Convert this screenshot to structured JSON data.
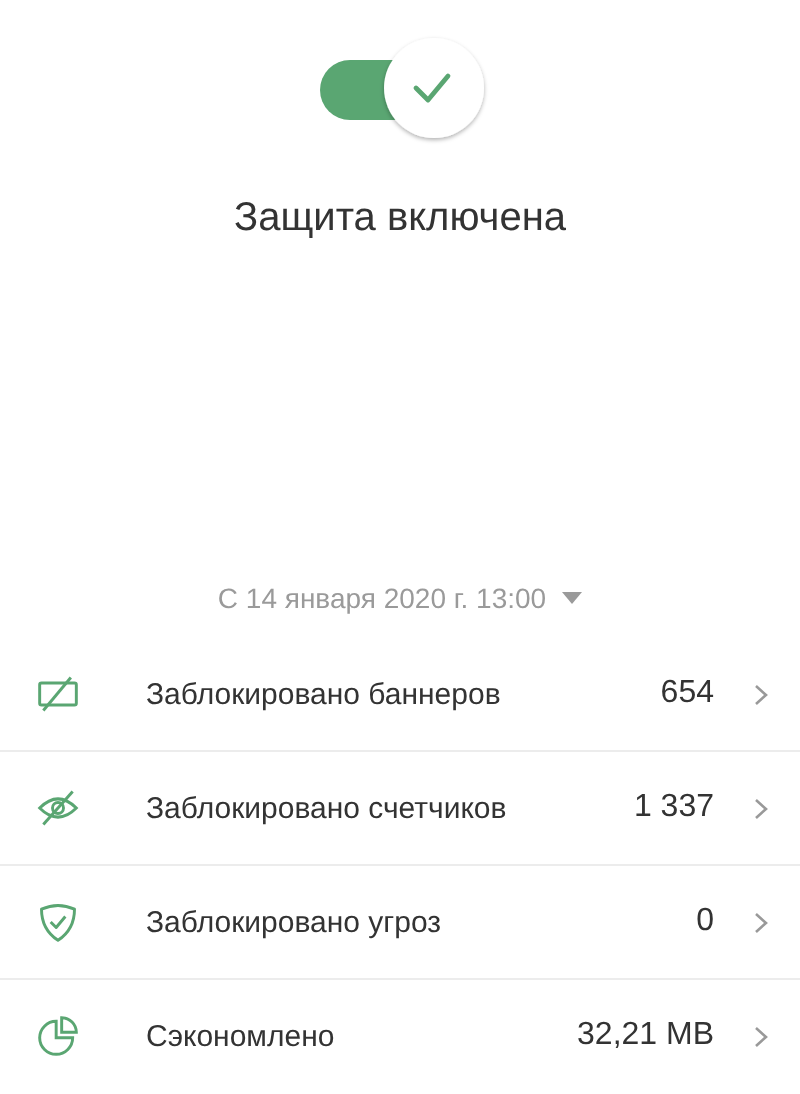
{
  "protection": {
    "on": true,
    "title": "Защита включена"
  },
  "period": {
    "label": "С 14 января 2020 г. 13:00"
  },
  "stats": [
    {
      "kind": "banner",
      "label": "Заблокировано баннеров",
      "value": "654"
    },
    {
      "kind": "tracker",
      "label": "Заблокировано счетчиков",
      "value": "1 337"
    },
    {
      "kind": "threat",
      "label": "Заблокировано угроз",
      "value": "0"
    },
    {
      "kind": "saved",
      "label": "Сэкономлено",
      "value": "32,21 MB"
    }
  ]
}
